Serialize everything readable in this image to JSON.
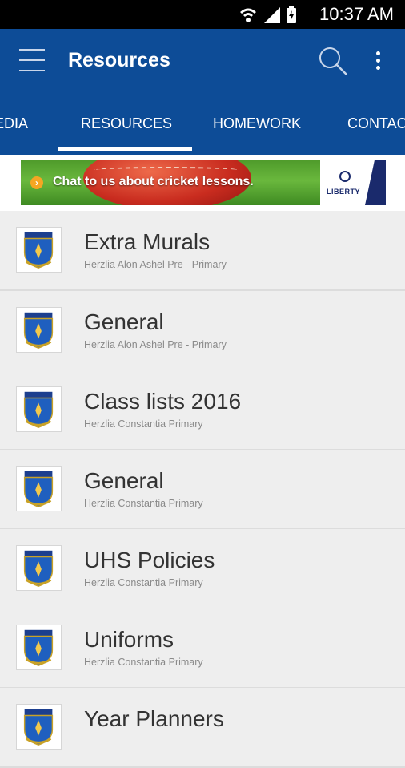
{
  "status_bar": {
    "time": "10:37 AM"
  },
  "app_bar": {
    "title": "Resources"
  },
  "tabs": [
    {
      "label": "MEDIA"
    },
    {
      "label": "RESOURCES"
    },
    {
      "label": "HOMEWORK"
    },
    {
      "label": "CONTACT"
    }
  ],
  "banner": {
    "text": "Chat to us about cricket lessons.",
    "brand": "LIBERTY"
  },
  "items": [
    {
      "title": "Extra Murals",
      "subtitle": "Herzlia Alon Ashel Pre - Primary"
    },
    {
      "title": "General",
      "subtitle": "Herzlia Alon Ashel Pre - Primary"
    },
    {
      "title": "Class lists 2016",
      "subtitle": "Herzlia Constantia Primary"
    },
    {
      "title": "General",
      "subtitle": "Herzlia Constantia Primary"
    },
    {
      "title": "UHS Policies",
      "subtitle": "Herzlia Constantia Primary"
    },
    {
      "title": "Uniforms",
      "subtitle": "Herzlia Constantia Primary"
    },
    {
      "title": "Year Planners",
      "subtitle": ""
    }
  ],
  "colors": {
    "primary": "#0d4c97",
    "background": "#eeeeee",
    "divider": "#dcdcdc"
  }
}
